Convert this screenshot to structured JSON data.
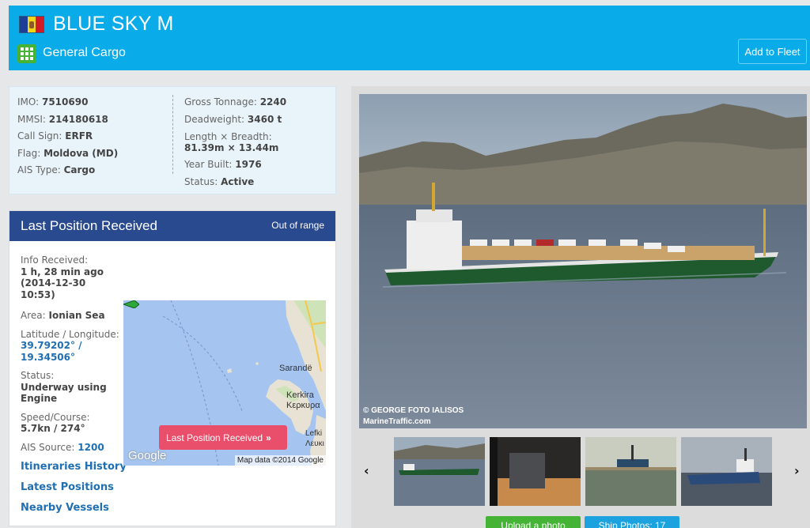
{
  "header": {
    "ship_name": "BLUE SKY M",
    "ship_type": "General Cargo",
    "add_to_fleet": "Add to Fleet",
    "flag_icon": "moldova-flag-icon",
    "type_icon": "general-cargo-icon",
    "background_color": "#0aabe9"
  },
  "info": {
    "left": [
      {
        "label": "IMO: ",
        "value": "7510690"
      },
      {
        "label": "MMSI: ",
        "value": "214180618"
      },
      {
        "label": "Call Sign: ",
        "value": "ERFR"
      },
      {
        "label": "Flag: ",
        "value": "Moldova (MD)"
      },
      {
        "label": "AIS Type: ",
        "value": "Cargo"
      }
    ],
    "right": {
      "gross_tonnage_label": "Gross Tonnage: ",
      "gross_tonnage": "2240",
      "deadweight_label": "Deadweight: ",
      "deadweight": "3460 t",
      "length_breadth_label": "Length × Breadth:",
      "length_breadth": "81.39m × 13.44m",
      "year_built_label": "Year Built: ",
      "year_built": "1976",
      "status_label": "Status: ",
      "status": "Active"
    }
  },
  "position": {
    "title": "Last Position Received",
    "range_status": "Out of range",
    "info_received_label": "Info Received:",
    "info_received_ago": "1 h, 28 min ago",
    "info_received_time": "(2014-12-30 10:53)",
    "area_label": "Area: ",
    "area": "Ionian Sea",
    "latlon_label": "Latitude / Longitude:",
    "lat": "39.79202° /",
    "lon": "19.34506°",
    "status_label": "Status:",
    "status": "Underway using Engine",
    "speed_label": "Speed/Course:",
    "speed": "5.7kn / 274°",
    "ais_source_label": "AIS Source: ",
    "ais_source": "1200",
    "links": [
      "Itineraries History",
      "Latest Positions",
      "Nearby Vessels"
    ],
    "map": {
      "button": "Last Position Received",
      "labels": [
        "Sarandë",
        "Kerkira",
        "Κερκυρα",
        "Lefki",
        "Λευκι"
      ],
      "google": "Google",
      "attribution": "Map data ©2014 Google"
    }
  },
  "photo": {
    "credit_line1": "© GEORGE FOTO IALISOS",
    "credit_line2": "MarineTraffic.com",
    "upload_label": "Upload a photo",
    "ship_photos_label": "Ship Photos: 17"
  }
}
